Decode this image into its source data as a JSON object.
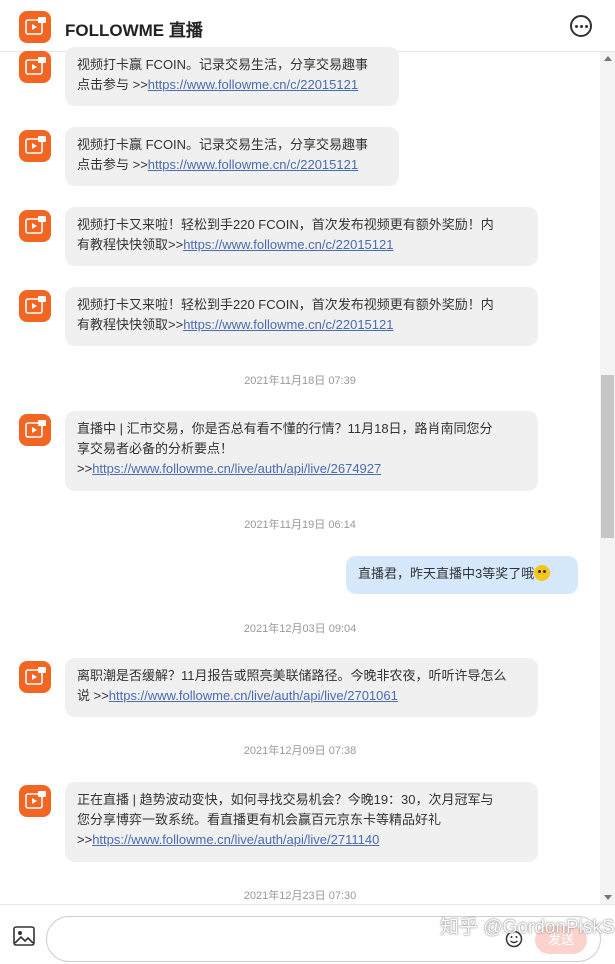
{
  "header": {
    "title": "FOLLOWME 直播"
  },
  "messages": [
    {
      "text": "视频打卡赢 FCOIN。记录交易生活，分享交易趣事\n点击参与 >>",
      "link": "https://www.followme.cn/c/22015121"
    },
    {
      "text": "视频打卡赢 FCOIN。记录交易生活，分享交易趣事\n点击参与 >>",
      "link": "https://www.followme.cn/c/22015121"
    },
    {
      "text": "视频打卡又来啦！轻松到手220 FCOIN，首次发布视频更有额外奖励！内\n有教程快快领取>>",
      "link": "https://www.followme.cn/c/22015121"
    },
    {
      "text": "视频打卡又来啦！轻松到手220 FCOIN，首次发布视频更有额外奖励！内\n有教程快快领取>>",
      "link": "https://www.followme.cn/c/22015121"
    },
    {
      "timestamp": "2021年11月18日 07:39"
    },
    {
      "text": "直播中 | 汇市交易，你是否总有看不懂的行情？11月18日，路肖南同您分\n享交易者必备的分析要点！\n>>",
      "link": "https://www.followme.cn/live/auth/api/live/2674927"
    },
    {
      "timestamp": "2021年11月19日 06:14"
    },
    {
      "mine": "直播君，昨天直播中3等奖了哦"
    },
    {
      "timestamp": "2021年12月03日 09:04"
    },
    {
      "text": "离职潮是否缓解？11月报告或照亮美联储路径。今晚非农夜，听听许导怎么\n说 >>",
      "link": "https://www.followme.cn/live/auth/api/live/2701061"
    },
    {
      "timestamp": "2021年12月09日 07:38"
    },
    {
      "text": "正在直播 | 趋势波动变快，如何寻找交易机会？今晚19：30，次月冠军与\n您分享博弈一致系统。看直播更有机会赢百元京东卡等精品好礼\n>>",
      "link": "https://www.followme.cn/live/auth/api/live/2711140"
    },
    {
      "timestamp": "2021年12月23日 07:30"
    }
  ],
  "composer": {
    "placeholder": "",
    "send_label": "发送"
  },
  "watermark": "知乎 @GordonPiskS",
  "colors": {
    "brand": "#f26522",
    "mine_bubble": "#d6e8fb",
    "link": "#4a6cb0"
  },
  "icons": {
    "header_more": "more-icon",
    "image": "image-icon",
    "emoji": "emoji-icon"
  }
}
